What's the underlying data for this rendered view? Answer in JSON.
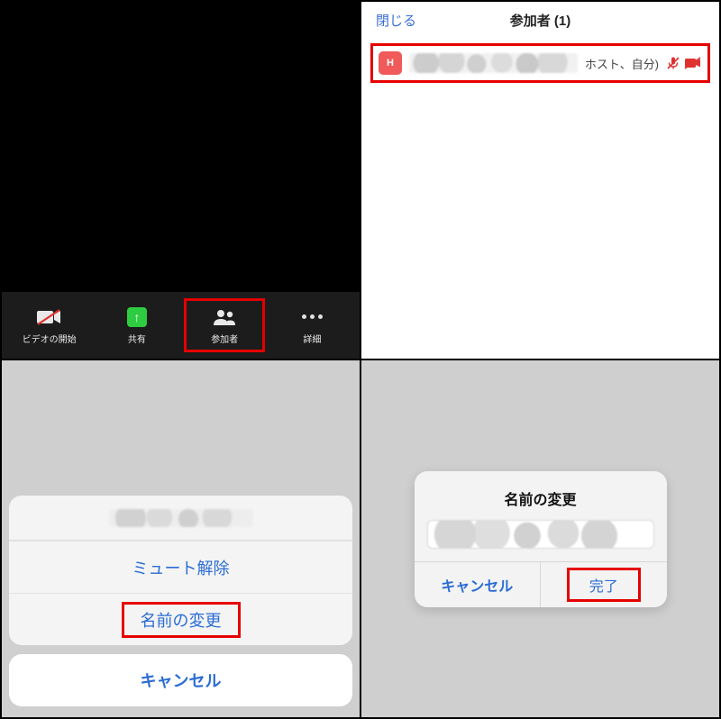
{
  "panel1": {
    "toolbar": {
      "video_label": "ビデオの開始",
      "share_label": "共有",
      "participants_label": "参加者",
      "more_label": "詳細",
      "share_arrow": "↑"
    }
  },
  "panel2": {
    "close_label": "閉じる",
    "title": "参加者 (1)",
    "avatar_letter": "H",
    "role_suffix": "ホスト、自分)"
  },
  "panel3": {
    "unmute_label": "ミュート解除",
    "rename_label": "名前の変更",
    "cancel_label": "キャンセル"
  },
  "panel4": {
    "dialog_title": "名前の変更",
    "cancel_label": "キャンセル",
    "done_label": "完了"
  }
}
